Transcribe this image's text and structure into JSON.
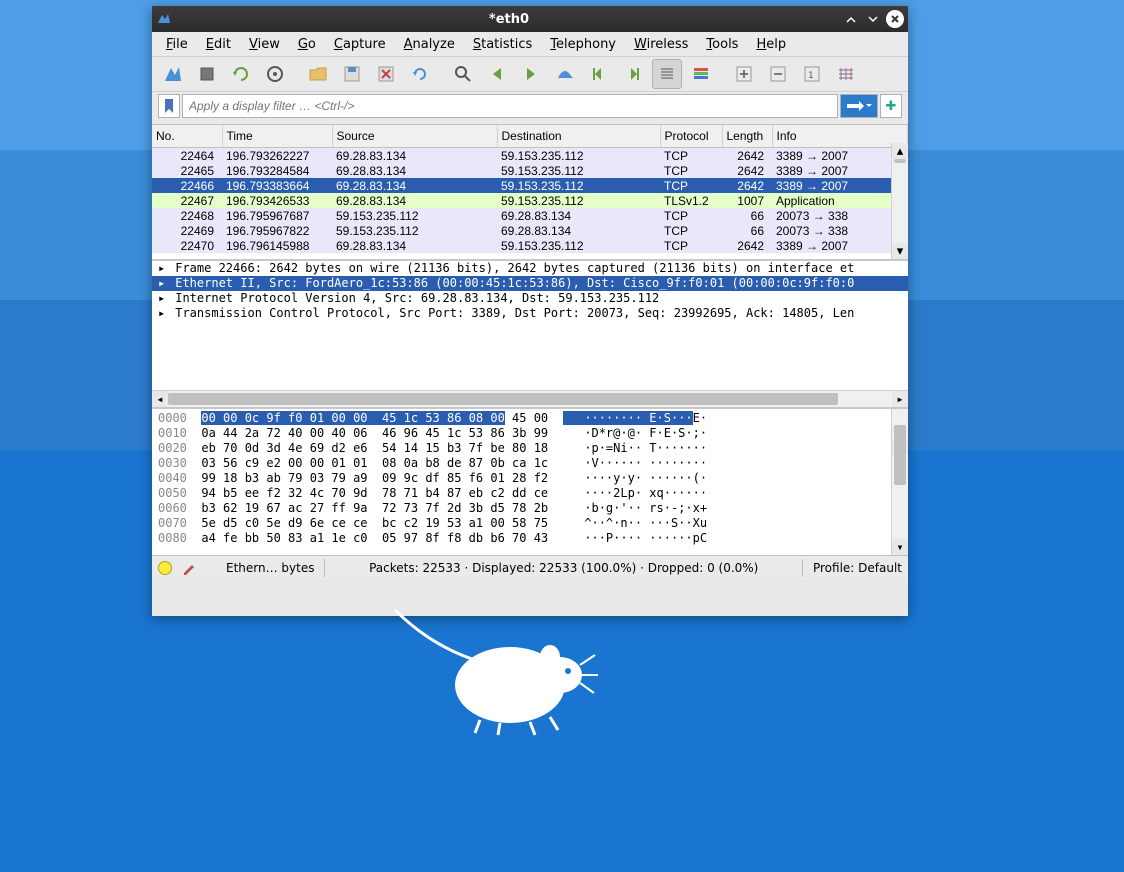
{
  "window": {
    "title": "*eth0"
  },
  "menu": [
    "File",
    "Edit",
    "View",
    "Go",
    "Capture",
    "Analyze",
    "Statistics",
    "Telephony",
    "Wireless",
    "Tools",
    "Help"
  ],
  "filter": {
    "placeholder": "Apply a display filter … <Ctrl-/>"
  },
  "packet_headers": [
    "No.",
    "Time",
    "Source",
    "Destination",
    "Protocol",
    "Length",
    "Info"
  ],
  "packets": [
    {
      "no": "22464",
      "time": "196.793262227",
      "src": "69.28.83.134",
      "dst": "59.153.235.112",
      "proto": "TCP",
      "len": "2642",
      "info": "3389 → 2007",
      "cls": "row-pale"
    },
    {
      "no": "22465",
      "time": "196.793284584",
      "src": "69.28.83.134",
      "dst": "59.153.235.112",
      "proto": "TCP",
      "len": "2642",
      "info": "3389 → 2007",
      "cls": "row-pale"
    },
    {
      "no": "22466",
      "time": "196.793383664",
      "src": "69.28.83.134",
      "dst": "59.153.235.112",
      "proto": "TCP",
      "len": "2642",
      "info": "3389 → 2007",
      "cls": "row-selected"
    },
    {
      "no": "22467",
      "time": "196.793426533",
      "src": "69.28.83.134",
      "dst": "59.153.235.112",
      "proto": "TLSv1.2",
      "len": "1007",
      "info": "Application",
      "cls": "row-green"
    },
    {
      "no": "22468",
      "time": "196.795967687",
      "src": "59.153.235.112",
      "dst": "69.28.83.134",
      "proto": "TCP",
      "len": "66",
      "info": "20073 → 338",
      "cls": "row-pale"
    },
    {
      "no": "22469",
      "time": "196.795967822",
      "src": "59.153.235.112",
      "dst": "69.28.83.134",
      "proto": "TCP",
      "len": "66",
      "info": "20073 → 338",
      "cls": "row-pale"
    },
    {
      "no": "22470",
      "time": "196.796145988",
      "src": "69.28.83.134",
      "dst": "59.153.235.112",
      "proto": "TCP",
      "len": "2642",
      "info": "3389 → 2007",
      "cls": "row-pale"
    }
  ],
  "details": [
    {
      "text": "Frame 22466: 2642 bytes on wire (21136 bits), 2642 bytes captured (21136 bits) on interface et",
      "sel": false
    },
    {
      "text": "Ethernet II, Src: FordAero_1c:53:86 (00:00:45:1c:53:86), Dst: Cisco_9f:f0:01 (00:00:0c:9f:f0:0",
      "sel": true
    },
    {
      "text": "Internet Protocol Version 4, Src: 69.28.83.134, Dst: 59.153.235.112",
      "sel": false
    },
    {
      "text": "Transmission Control Protocol, Src Port: 3389, Dst Port: 20073, Seq: 23992695, Ack: 14805, Len",
      "sel": false
    }
  ],
  "hex": [
    {
      "off": "0000",
      "b1": "00 00 0c 9f f0 01 00 00  45 1c 53 86 08 00",
      "b2": " 45 00",
      "a": "   ········ E·S···",
      "a2": "E·"
    },
    {
      "off": "0010",
      "b1": "0a 44 2a 72 40 00 40 06  46 96 45 1c 53 86 3b 99",
      "b2": "",
      "a": "   ·D*r@·@· F·E·S·;·",
      "a2": ""
    },
    {
      "off": "0020",
      "b1": "eb 70 0d 3d 4e 69 d2 e6  54 14 15 b3 7f be 80 18",
      "b2": "",
      "a": "   ·p·=Ni·· T·······",
      "a2": ""
    },
    {
      "off": "0030",
      "b1": "03 56 c9 e2 00 00 01 01  08 0a b8 de 87 0b ca 1c",
      "b2": "",
      "a": "   ·V······ ········",
      "a2": ""
    },
    {
      "off": "0040",
      "b1": "99 18 b3 ab 79 03 79 a9  09 9c df 85 f6 01 28 f2",
      "b2": "",
      "a": "   ····y·y· ······(·",
      "a2": ""
    },
    {
      "off": "0050",
      "b1": "94 b5 ee f2 32 4c 70 9d  78 71 b4 87 eb c2 dd ce",
      "b2": "",
      "a": "   ····2Lp· xq······",
      "a2": ""
    },
    {
      "off": "0060",
      "b1": "b3 62 19 67 ac 27 ff 9a  72 73 7f 2d 3b d5 78 2b",
      "b2": "",
      "a": "   ·b·g·'·· rs·-;·x+",
      "a2": ""
    },
    {
      "off": "0070",
      "b1": "5e d5 c0 5e d9 6e ce ce  bc c2 19 53 a1 00 58 75",
      "b2": "",
      "a": "   ^··^·n·· ···S··Xu",
      "a2": ""
    },
    {
      "off": "0080",
      "b1": "a4 fe bb 50 83 a1 1e c0  05 97 8f f8 db b6 70 43",
      "b2": "",
      "a": "   ···P···· ······pC",
      "a2": ""
    }
  ],
  "status": {
    "left": "Ethern… bytes",
    "mid": "Packets: 22533 · Displayed: 22533 (100.0%) · Dropped: 0 (0.0%)",
    "right": "Profile: Default"
  }
}
